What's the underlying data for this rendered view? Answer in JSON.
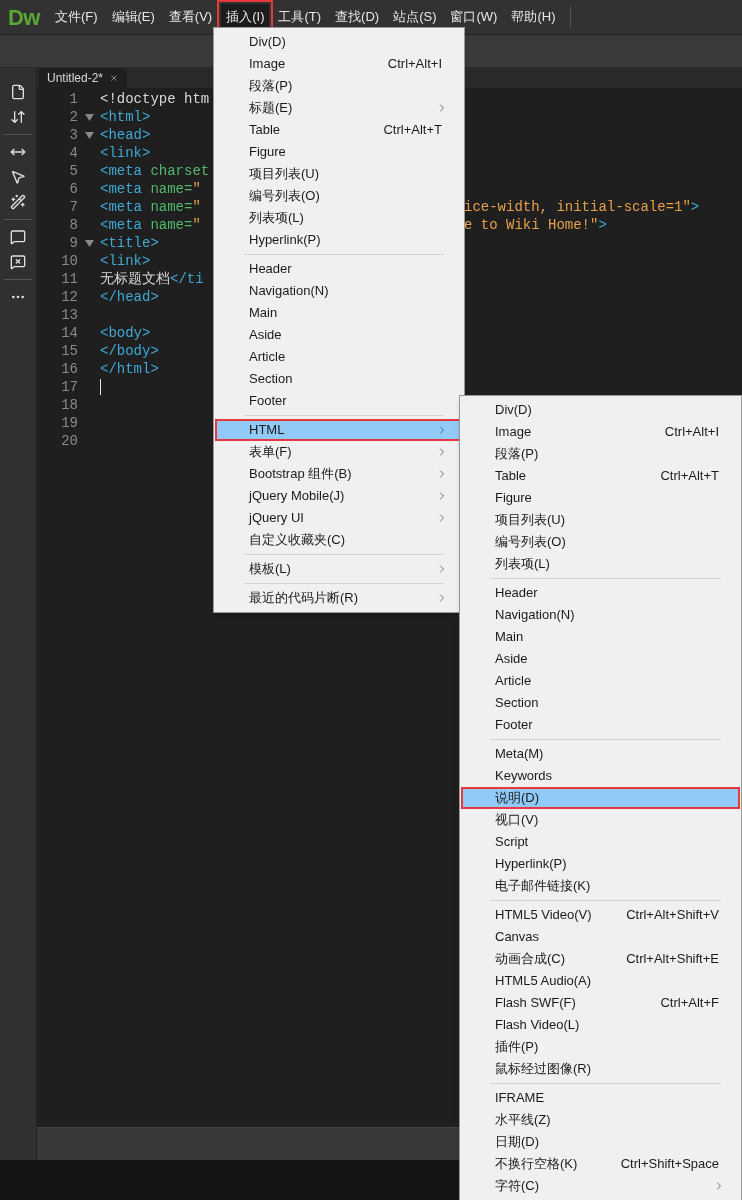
{
  "app_logo": "Dw",
  "menubar": [
    {
      "label": "文件(F)",
      "selected": false,
      "outlined": false
    },
    {
      "label": "编辑(E)",
      "selected": false,
      "outlined": false
    },
    {
      "label": "查看(V)",
      "selected": false,
      "outlined": false
    },
    {
      "label": "插入(I)",
      "selected": true,
      "outlined": true
    },
    {
      "label": "工具(T)",
      "selected": false,
      "outlined": false
    },
    {
      "label": "查找(D)",
      "selected": false,
      "outlined": false
    },
    {
      "label": "站点(S)",
      "selected": false,
      "outlined": false
    },
    {
      "label": "窗口(W)",
      "selected": false,
      "outlined": false
    },
    {
      "label": "帮助(H)",
      "selected": false,
      "outlined": false
    }
  ],
  "document_tab": {
    "title": "Untitled-2*"
  },
  "code_lines": [
    {
      "number": "1",
      "foldable": false,
      "cursor": false,
      "segments": [
        {
          "kind": "plain",
          "text": "<!doctype htm"
        }
      ]
    },
    {
      "number": "2",
      "foldable": true,
      "cursor": false,
      "segments": [
        {
          "kind": "tag",
          "text": "<html>"
        }
      ]
    },
    {
      "number": "3",
      "foldable": true,
      "cursor": false,
      "segments": [
        {
          "kind": "tag",
          "text": "<head>"
        }
      ]
    },
    {
      "number": "4",
      "foldable": false,
      "cursor": false,
      "segments": [
        {
          "kind": "tag",
          "text": "<link>"
        }
      ]
    },
    {
      "number": "5",
      "foldable": false,
      "cursor": false,
      "segments": [
        {
          "kind": "tag",
          "text": "<meta"
        },
        {
          "kind": "attr",
          "text": " charset"
        }
      ]
    },
    {
      "number": "6",
      "foldable": false,
      "cursor": false,
      "segments": [
        {
          "kind": "tag",
          "text": "<meta"
        },
        {
          "kind": "attr",
          "text": " name="
        },
        {
          "kind": "string",
          "text": "\""
        }
      ]
    },
    {
      "number": "7",
      "foldable": false,
      "cursor": false,
      "segments": [
        {
          "kind": "tag",
          "text": "<meta"
        },
        {
          "kind": "attr",
          "text": " name="
        },
        {
          "kind": "string",
          "text": "\""
        }
      ],
      "tail": [
        {
          "kind": "string",
          "text": "ice-width, initial-scale=1\""
        },
        {
          "kind": "tag",
          "text": ">"
        }
      ]
    },
    {
      "number": "8",
      "foldable": false,
      "cursor": false,
      "segments": [
        {
          "kind": "tag",
          "text": "<meta"
        },
        {
          "kind": "attr",
          "text": " name="
        },
        {
          "kind": "string",
          "text": "\""
        }
      ],
      "tail": [
        {
          "kind": "string",
          "text": "e to Wiki Home!\""
        },
        {
          "kind": "tag",
          "text": ">"
        }
      ]
    },
    {
      "number": "9",
      "foldable": true,
      "cursor": false,
      "segments": [
        {
          "kind": "tag",
          "text": "<title>"
        }
      ]
    },
    {
      "number": "10",
      "foldable": false,
      "cursor": false,
      "segments": [
        {
          "kind": "tag",
          "text": "<link>"
        }
      ]
    },
    {
      "number": "11",
      "foldable": false,
      "cursor": false,
      "segments": [
        {
          "kind": "plain",
          "text": "无标题文档"
        },
        {
          "kind": "tag",
          "text": "</ti"
        }
      ]
    },
    {
      "number": "12",
      "foldable": false,
      "cursor": false,
      "segments": [
        {
          "kind": "tag",
          "text": "</head>"
        }
      ]
    },
    {
      "number": "13",
      "foldable": false,
      "cursor": false
    },
    {
      "number": "14",
      "foldable": false,
      "cursor": false,
      "segments": [
        {
          "kind": "tag",
          "text": "<body>"
        }
      ]
    },
    {
      "number": "15",
      "foldable": false,
      "cursor": false,
      "segments": [
        {
          "kind": "tag",
          "text": "</body>"
        }
      ]
    },
    {
      "number": "16",
      "foldable": false,
      "cursor": false,
      "segments": [
        {
          "kind": "tag",
          "text": "</html>"
        }
      ]
    },
    {
      "number": "17",
      "foldable": false,
      "cursor": true
    },
    {
      "number": "18",
      "foldable": false,
      "cursor": false
    },
    {
      "number": "19",
      "foldable": false,
      "cursor": false
    },
    {
      "number": "20",
      "foldable": false,
      "cursor": false
    }
  ],
  "insert_menu": [
    {
      "kind": "item",
      "label": "Div(D)",
      "selected": false,
      "outlined": false
    },
    {
      "kind": "item",
      "label": "Image",
      "shortcut": "Ctrl+Alt+I",
      "selected": false,
      "outlined": false
    },
    {
      "kind": "item",
      "label": "段落(P)",
      "selected": false,
      "outlined": false
    },
    {
      "kind": "item",
      "label": "标题(E)",
      "submenu": true,
      "selected": false,
      "outlined": false
    },
    {
      "kind": "item",
      "label": "Table",
      "shortcut": "Ctrl+Alt+T",
      "selected": false,
      "outlined": false
    },
    {
      "kind": "item",
      "label": "Figure",
      "selected": false,
      "outlined": false
    },
    {
      "kind": "item",
      "label": "项目列表(U)",
      "selected": false,
      "outlined": false
    },
    {
      "kind": "item",
      "label": "编号列表(O)",
      "selected": false,
      "outlined": false
    },
    {
      "kind": "item",
      "label": "列表项(L)",
      "selected": false,
      "outlined": false
    },
    {
      "kind": "item",
      "label": "Hyperlink(P)",
      "selected": false,
      "outlined": false
    },
    {
      "kind": "separator"
    },
    {
      "kind": "item",
      "label": "Header",
      "selected": false,
      "outlined": false
    },
    {
      "kind": "item",
      "label": "Navigation(N)",
      "selected": false,
      "outlined": false
    },
    {
      "kind": "item",
      "label": "Main",
      "selected": false,
      "outlined": false
    },
    {
      "kind": "item",
      "label": "Aside",
      "selected": false,
      "outlined": false
    },
    {
      "kind": "item",
      "label": "Article",
      "selected": false,
      "outlined": false
    },
    {
      "kind": "item",
      "label": "Section",
      "selected": false,
      "outlined": false
    },
    {
      "kind": "item",
      "label": "Footer",
      "selected": false,
      "outlined": false
    },
    {
      "kind": "separator"
    },
    {
      "kind": "item",
      "label": "HTML",
      "submenu": true,
      "selected": true,
      "outlined": true
    },
    {
      "kind": "item",
      "label": "表单(F)",
      "submenu": true,
      "selected": false,
      "outlined": false
    },
    {
      "kind": "item",
      "label": "Bootstrap 组件(B)",
      "submenu": true,
      "selected": false,
      "outlined": false
    },
    {
      "kind": "item",
      "label": "jQuery Mobile(J)",
      "submenu": true,
      "selected": false,
      "outlined": false
    },
    {
      "kind": "item",
      "label": "jQuery UI",
      "submenu": true,
      "selected": false,
      "outlined": false
    },
    {
      "kind": "item",
      "label": "自定义收藏夹(C)",
      "selected": false,
      "outlined": false
    },
    {
      "kind": "separator"
    },
    {
      "kind": "item",
      "label": "模板(L)",
      "submenu": true,
      "selected": false,
      "outlined": false
    },
    {
      "kind": "separator"
    },
    {
      "kind": "item",
      "label": "最近的代码片断(R)",
      "submenu": true,
      "selected": false,
      "outlined": false
    }
  ],
  "html_submenu": [
    {
      "kind": "item",
      "label": "Div(D)",
      "selected": false,
      "outlined": false
    },
    {
      "kind": "item",
      "label": "Image",
      "shortcut": "Ctrl+Alt+I",
      "selected": false,
      "outlined": false
    },
    {
      "kind": "item",
      "label": "段落(P)",
      "selected": false,
      "outlined": false
    },
    {
      "kind": "item",
      "label": "Table",
      "shortcut": "Ctrl+Alt+T",
      "selected": false,
      "outlined": false
    },
    {
      "kind": "item",
      "label": "Figure",
      "selected": false,
      "outlined": false
    },
    {
      "kind": "item",
      "label": "项目列表(U)",
      "selected": false,
      "outlined": false
    },
    {
      "kind": "item",
      "label": "编号列表(O)",
      "selected": false,
      "outlined": false
    },
    {
      "kind": "item",
      "label": "列表项(L)",
      "selected": false,
      "outlined": false
    },
    {
      "kind": "separator"
    },
    {
      "kind": "item",
      "label": "Header",
      "selected": false,
      "outlined": false
    },
    {
      "kind": "item",
      "label": "Navigation(N)",
      "selected": false,
      "outlined": false
    },
    {
      "kind": "item",
      "label": "Main",
      "selected": false,
      "outlined": false
    },
    {
      "kind": "item",
      "label": "Aside",
      "selected": false,
      "outlined": false
    },
    {
      "kind": "item",
      "label": "Article",
      "selected": false,
      "outlined": false
    },
    {
      "kind": "item",
      "label": "Section",
      "selected": false,
      "outlined": false
    },
    {
      "kind": "item",
      "label": "Footer",
      "selected": false,
      "outlined": false
    },
    {
      "kind": "separator"
    },
    {
      "kind": "item",
      "label": "Meta(M)",
      "selected": false,
      "outlined": false
    },
    {
      "kind": "item",
      "label": "Keywords",
      "selected": false,
      "outlined": false
    },
    {
      "kind": "item",
      "label": "说明(D)",
      "selected": true,
      "outlined": true
    },
    {
      "kind": "item",
      "label": "视口(V)",
      "selected": false,
      "outlined": false
    },
    {
      "kind": "item",
      "label": "Script",
      "selected": false,
      "outlined": false
    },
    {
      "kind": "item",
      "label": "Hyperlink(P)",
      "selected": false,
      "outlined": false
    },
    {
      "kind": "item",
      "label": "电子邮件链接(K)",
      "selected": false,
      "outlined": false
    },
    {
      "kind": "separator"
    },
    {
      "kind": "item",
      "label": "HTML5 Video(V)",
      "shortcut": "Ctrl+Alt+Shift+V",
      "selected": false,
      "outlined": false
    },
    {
      "kind": "item",
      "label": "Canvas",
      "selected": false,
      "outlined": false
    },
    {
      "kind": "item",
      "label": "动画合成(C)",
      "shortcut": "Ctrl+Alt+Shift+E",
      "selected": false,
      "outlined": false
    },
    {
      "kind": "item",
      "label": "HTML5 Audio(A)",
      "selected": false,
      "outlined": false
    },
    {
      "kind": "item",
      "label": "Flash SWF(F)",
      "shortcut": "Ctrl+Alt+F",
      "selected": false,
      "outlined": false
    },
    {
      "kind": "item",
      "label": "Flash Video(L)",
      "selected": false,
      "outlined": false
    },
    {
      "kind": "item",
      "label": "插件(P)",
      "selected": false,
      "outlined": false
    },
    {
      "kind": "item",
      "label": "鼠标经过图像(R)",
      "selected": false,
      "outlined": false
    },
    {
      "kind": "separator"
    },
    {
      "kind": "item",
      "label": "IFRAME",
      "selected": false,
      "outlined": false
    },
    {
      "kind": "item",
      "label": "水平线(Z)",
      "selected": false,
      "outlined": false
    },
    {
      "kind": "item",
      "label": "日期(D)",
      "selected": false,
      "outlined": false
    },
    {
      "kind": "item",
      "label": "不换行空格(K)",
      "shortcut": "Ctrl+Shift+Space",
      "selected": false,
      "outlined": false
    },
    {
      "kind": "item",
      "label": "字符(C)",
      "submenu": true,
      "selected": false,
      "outlined": false
    }
  ]
}
